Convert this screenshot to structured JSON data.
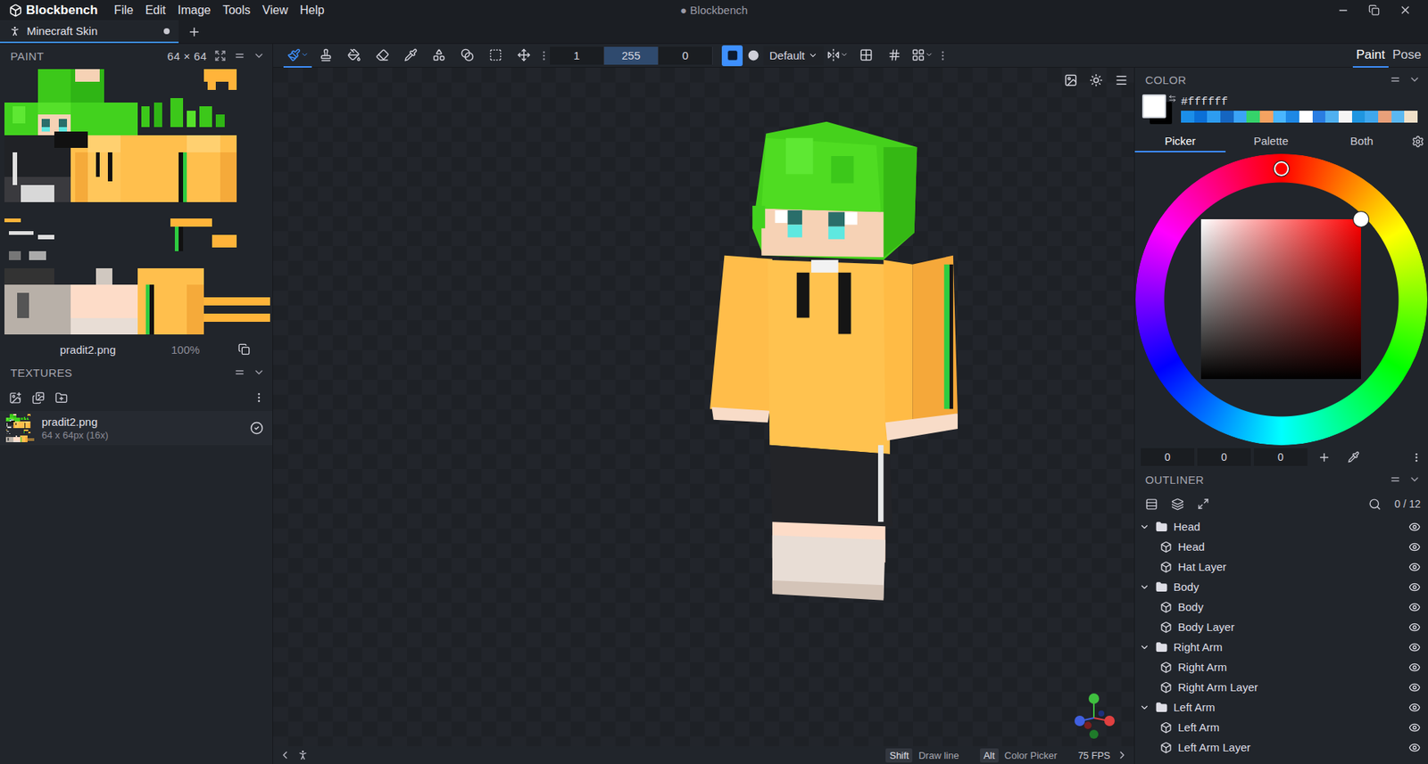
{
  "window": {
    "app": "Blockbench",
    "title": "● Blockbench",
    "menu": [
      "File",
      "Edit",
      "Image",
      "Tools",
      "View",
      "Help"
    ]
  },
  "tabs": [
    {
      "label": "Minecraft Skin",
      "selected": true,
      "unsaved": true
    }
  ],
  "toolbar": {
    "tools": [
      {
        "kind": "brush",
        "selected": true
      },
      {
        "kind": "stamp",
        "selected": false
      },
      {
        "kind": "fill",
        "selected": false
      },
      {
        "kind": "eraser",
        "selected": false
      },
      {
        "kind": "picker",
        "selected": false
      },
      {
        "kind": "shapes",
        "selected": false
      },
      {
        "kind": "gradient",
        "selected": false
      },
      {
        "kind": "select",
        "selected": false
      },
      {
        "kind": "move",
        "selected": false
      }
    ],
    "sliders": [
      {
        "value": "1",
        "level": 0
      },
      {
        "value": "255",
        "level": 1
      },
      {
        "value": "0",
        "level": 0
      }
    ],
    "brush_shapes": [
      {
        "kind": "square",
        "selected": true
      },
      {
        "kind": "round",
        "selected": false
      }
    ],
    "blend_mode": "Default"
  },
  "modes": [
    {
      "label": "Paint",
      "selected": true
    },
    {
      "label": "Pose",
      "selected": false
    }
  ],
  "paint_panel": {
    "title": "PAINT",
    "size": "64 × 64",
    "texture": "pradit2.png",
    "zoom": "100%"
  },
  "textures_panel": {
    "title": "TEXTURES",
    "items": [
      {
        "name": "pradit2.png",
        "info": "64 x 64px (16x)",
        "selected": true
      }
    ]
  },
  "color_panel": {
    "title": "COLOR",
    "hex": "#ffffff",
    "hue": 0,
    "saturation": 1,
    "value": 1,
    "swatches": [
      {
        "color": "#1b8ee8"
      },
      {
        "color": "#0b6fd6"
      },
      {
        "color": "#2d9cf0"
      },
      {
        "color": "#1565c0"
      },
      {
        "color": "#3ba3f5"
      },
      {
        "color": "#35d36a"
      },
      {
        "color": "#f4a261"
      },
      {
        "color": "#49b6ff"
      },
      {
        "color": "#1e88e5"
      },
      {
        "color": "#ffffff"
      },
      {
        "color": "#2a7de1"
      },
      {
        "color": "#4fb0f0"
      },
      {
        "color": "#f5f5f5"
      },
      {
        "color": "#1f95e0"
      },
      {
        "color": "#3fa7ee"
      },
      {
        "color": "#e8a07a"
      },
      {
        "color": "#5ab8f2"
      },
      {
        "color": "#f0e0c8"
      }
    ],
    "tabs": [
      {
        "label": "Picker",
        "selected": true
      },
      {
        "label": "Palette",
        "selected": false
      },
      {
        "label": "Both",
        "selected": false
      }
    ],
    "rgb": [
      "0",
      "0",
      "0"
    ]
  },
  "outliner": {
    "title": "OUTLINER",
    "count": "0 / 12",
    "items": [
      {
        "label": "Head",
        "kind": "group",
        "expanded": true,
        "visible": true
      },
      {
        "label": "Head",
        "kind": "cube",
        "expanded": false,
        "visible": true
      },
      {
        "label": "Hat Layer",
        "kind": "cube",
        "expanded": false,
        "visible": true
      },
      {
        "label": "Body",
        "kind": "group",
        "expanded": true,
        "visible": true
      },
      {
        "label": "Body",
        "kind": "cube",
        "expanded": false,
        "visible": true
      },
      {
        "label": "Body Layer",
        "kind": "cube",
        "expanded": false,
        "visible": true
      },
      {
        "label": "Right Arm",
        "kind": "group",
        "expanded": true,
        "visible": true
      },
      {
        "label": "Right Arm",
        "kind": "cube",
        "expanded": false,
        "visible": true
      },
      {
        "label": "Right Arm Layer",
        "kind": "cube",
        "expanded": false,
        "visible": true
      },
      {
        "label": "Left Arm",
        "kind": "group",
        "expanded": true,
        "visible": true
      },
      {
        "label": "Left Arm",
        "kind": "cube",
        "expanded": false,
        "visible": true
      },
      {
        "label": "Left Arm Layer",
        "kind": "cube",
        "expanded": false,
        "visible": true
      }
    ]
  },
  "status_bar": {
    "hints": [
      {
        "key": "Shift",
        "label": "Draw line"
      },
      {
        "key": "Alt",
        "label": "Color Picker"
      }
    ],
    "fps": "75 FPS"
  }
}
